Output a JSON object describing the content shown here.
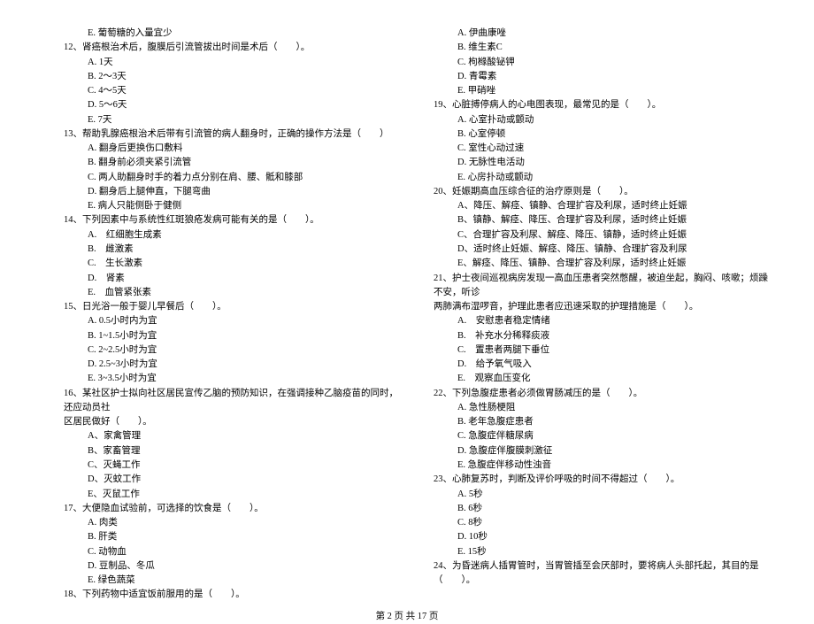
{
  "left": {
    "pre_option": "E. 葡萄糖的入量宜少",
    "q12": {
      "stem": "12、肾癌根治术后，腹膜后引流管拔出时间是术后（　　）。",
      "opts": [
        "A. 1天",
        "B. 2～3天",
        "C. 4～5天",
        "D. 5～6天",
        "E. 7天"
      ]
    },
    "q13": {
      "stem": "13、帮助乳腺癌根治术后带有引流管的病人翻身时，正确的操作方法是（　　）",
      "opts": [
        "A. 翻身后更换伤口敷料",
        "B. 翻身前必须夹紧引流管",
        "C. 两人助翻身时手的着力点分别在肩、腰、骶和膝部",
        "D. 翻身后上腿伸直，下腿弯曲",
        "E. 病人只能侧卧于健侧"
      ]
    },
    "q14": {
      "stem": "14、下列因素中与系统性红斑狼疮发病可能有关的是（　　）。",
      "opts": [
        "A.　红细胞生成素",
        "B.　雌激素",
        "C.　生长激素",
        "D.　肾素",
        "E.　血管紧张素"
      ]
    },
    "q15": {
      "stem": "15、日光浴一般于婴儿早餐后（　　）。",
      "opts": [
        "A. 0.5小时内为宜",
        "B. 1~1.5小时为宜",
        "C. 2~2.5小时为宜",
        "D. 2.5~3小时为宜",
        "E. 3~3.5小时为宜"
      ]
    },
    "q16": {
      "stem_l1": "16、某社区护士拟向社区居民宣传乙脑的预防知识，在强调接种乙脑疫苗的同时，还应动员社",
      "stem_l2": "区居民做好（　　）。",
      "opts": [
        "A、家禽管理",
        "B、家畜管理",
        "C、灭蝇工作",
        "D、灭蚊工作",
        "E、灭鼠工作"
      ]
    },
    "q17": {
      "stem": "17、大便隐血试验前，可选择的饮食是（　　）。",
      "opts": [
        "A. 肉类",
        "B. 肝类",
        "C. 动物血",
        "D. 豆制品、冬瓜",
        "E. 绿色蔬菜"
      ]
    },
    "q18": {
      "stem": "18、下列药物中适宜饭前服用的是（　　）。"
    }
  },
  "right": {
    "pre_opts": [
      "A. 伊曲康唑",
      "B. 维生素C",
      "C. 枸橼酸铋钾",
      "D. 青霉素",
      "E. 甲硝唑"
    ],
    "q19": {
      "stem": "19、心脏搏停病人的心电图表现，最常见的是（　　）。",
      "opts": [
        "A. 心室扑动或颤动",
        "B. 心室停顿",
        "C. 室性心动过速",
        "D. 无脉性电活动",
        "E. 心房扑动或颤动"
      ]
    },
    "gap1": "",
    "q20": {
      "stem": "20、妊娠期高血压综合征的治疗原则是（　　）。",
      "opts": [
        "A、降压、解痉、镇静、合理扩容及利尿，适时终止妊娠",
        "B、镇静、解痉、降压、合理扩容及利尿，适时终止妊娠",
        "C、合理扩容及利尿、解痉、降压、镇静，适时终止妊娠",
        "D、适时终止妊娠、解痉、降压、镇静、合理扩容及利尿",
        "E、解痉、降压、镇静、合理扩容及利尿，适时终止妊娠"
      ]
    },
    "q21": {
      "stem_l1": "21、护士夜间巡视病房发现一高血压患者突然憋醒，被迫坐起，胸闷、咳嗽；烦躁不安，听诊",
      "stem_l2": "两肺满布湿啰音，护理此患者应迅速采取的护理措施是（　　）。",
      "opts": [
        "A.　安慰患者稳定情绪",
        "B.　补充水分稀释痰液",
        "C.　置患者两腿下垂位",
        "D.　给予氧气吸入",
        "E.　观察血压变化"
      ]
    },
    "q22": {
      "stem": "22、下列急腹症患者必须做胃肠减压的是（　　）。",
      "opts": [
        "A. 急性肠梗阻",
        "B. 老年急腹症患者",
        "C. 急腹症伴糖尿病",
        "D. 急腹症伴腹膜刺激征",
        "E. 急腹症伴移动性浊音"
      ]
    },
    "gap2": "",
    "q23": {
      "stem": "23、心肺复苏时，判断及评价呼吸的时间不得超过（　　）。",
      "opts": [
        "A. 5秒",
        "B. 6秒",
        "C. 8秒",
        "D. 10秒",
        "E. 15秒"
      ]
    },
    "q24": {
      "stem": "24、为昏迷病人插胃管时，当胃管插至会厌部时，要将病人头部托起，其目的是（　　）。"
    }
  },
  "footer": "第 2 页 共 17 页"
}
